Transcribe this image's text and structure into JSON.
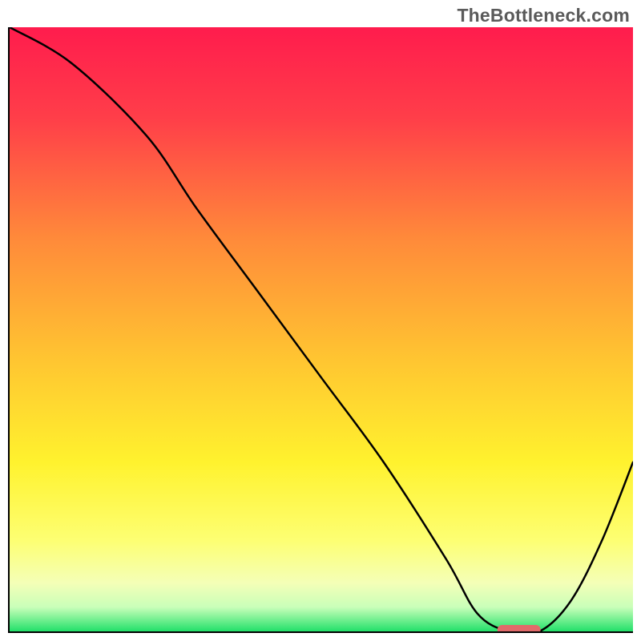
{
  "watermark": "TheBottleneck.com",
  "chart_data": {
    "type": "line",
    "title": "",
    "xlabel": "",
    "ylabel": "",
    "xlim": [
      0,
      100
    ],
    "ylim": [
      0,
      100
    ],
    "x": [
      0,
      10,
      22,
      30,
      40,
      50,
      60,
      70,
      75,
      80,
      85,
      90,
      95,
      100
    ],
    "y": [
      100,
      94,
      82,
      70,
      56,
      42,
      28,
      12,
      3,
      0,
      0,
      5,
      15,
      28
    ],
    "marker": {
      "x_start": 78,
      "x_end": 85,
      "y": 0
    },
    "gradient_stops": [
      {
        "offset": 0,
        "color": "#ff1c4d"
      },
      {
        "offset": 15,
        "color": "#ff3e49"
      },
      {
        "offset": 35,
        "color": "#ff8a3a"
      },
      {
        "offset": 55,
        "color": "#ffc531"
      },
      {
        "offset": 72,
        "color": "#fff22e"
      },
      {
        "offset": 85,
        "color": "#fdff73"
      },
      {
        "offset": 92,
        "color": "#f4ffb7"
      },
      {
        "offset": 96,
        "color": "#c9ffb9"
      },
      {
        "offset": 100,
        "color": "#22e06a"
      }
    ]
  }
}
